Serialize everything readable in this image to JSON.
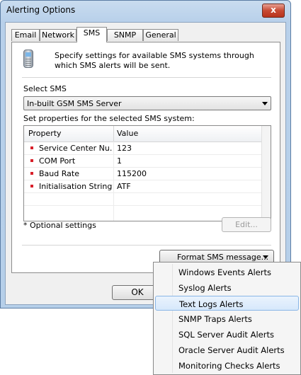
{
  "window": {
    "title": "Alerting Options",
    "close_glyph": "x"
  },
  "tabs": [
    {
      "label": "Email"
    },
    {
      "label": "Network"
    },
    {
      "label": "SMS",
      "active": true
    },
    {
      "label": "SNMP"
    },
    {
      "label": "General"
    }
  ],
  "sms": {
    "icon": "mobile-phone-icon",
    "description": "Specify settings for available SMS systems through which SMS alerts will be sent.",
    "select_label": "Select SMS",
    "selected_system": "In-built GSM SMS Server",
    "properties_label": "Set properties for the selected SMS system:",
    "grid": {
      "headers": [
        "Property",
        "Value"
      ],
      "rows": [
        {
          "property": "Service Center Nu...",
          "value": "123"
        },
        {
          "property": "COM Port",
          "value": "1"
        },
        {
          "property": "Baud Rate",
          "value": "115200"
        },
        {
          "property": "Initialisation String*",
          "value": "ATF"
        }
      ]
    },
    "optional_note": "* Optional settings",
    "edit_label": "Edit...",
    "format_button_label": "Format SMS message..."
  },
  "ok_label": "OK",
  "format_menu": {
    "items": [
      "Windows Events Alerts",
      "Syslog Alerts",
      "Text Logs Alerts",
      "SNMP Traps Alerts",
      "SQL Server Audit Alerts",
      "Oracle Server Audit Alerts",
      "Monitoring Checks Alerts"
    ],
    "highlighted": "Text Logs Alerts"
  },
  "colors": {
    "bullet": "#d8202a",
    "highlight_border": "#8ab6e6"
  }
}
